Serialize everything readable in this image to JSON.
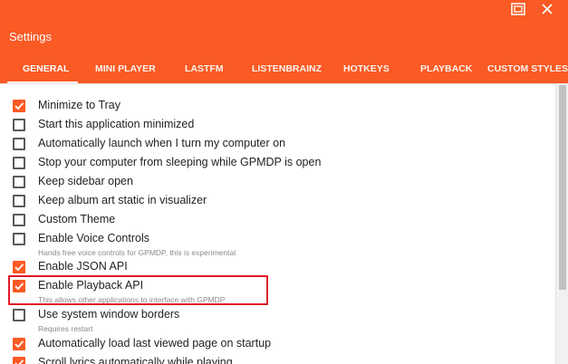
{
  "window": {
    "title": "Settings",
    "buttons": {
      "restore_icon": "restore-icon",
      "close_icon": "close-icon"
    }
  },
  "colors": {
    "accent": "#fa5a24",
    "highlight_box": "#e0182a"
  },
  "tabs": [
    {
      "label": "GENERAL",
      "active": true
    },
    {
      "label": "MINI PLAYER",
      "active": false
    },
    {
      "label": "LASTFM",
      "active": false
    },
    {
      "label": "LISTENBRAINZ",
      "active": false
    },
    {
      "label": "HOTKEYS",
      "active": false
    },
    {
      "label": "PLAYBACK",
      "active": false
    },
    {
      "label": "CUSTOM STYLES",
      "active": false
    }
  ],
  "options": [
    {
      "label": "Minimize to Tray",
      "checked": true,
      "sub": ""
    },
    {
      "label": "Start this application minimized",
      "checked": false,
      "sub": ""
    },
    {
      "label": "Automatically launch when I turn my computer on",
      "checked": false,
      "sub": ""
    },
    {
      "label": "Stop your computer from sleeping while GPMDP is open",
      "checked": false,
      "sub": ""
    },
    {
      "label": "Keep sidebar open",
      "checked": false,
      "sub": ""
    },
    {
      "label": "Keep album art static in visualizer",
      "checked": false,
      "sub": ""
    },
    {
      "label": "Custom Theme",
      "checked": false,
      "sub": ""
    },
    {
      "label": "Enable Voice Controls",
      "checked": false,
      "sub": "Hands free voice controls for GPMDP, this is experimental"
    },
    {
      "label": "Enable JSON API",
      "checked": true,
      "sub": ""
    },
    {
      "label": "Enable Playback API",
      "checked": true,
      "sub": "This allows other applications to interface with GPMDP"
    },
    {
      "label": "Use system window borders",
      "checked": false,
      "sub": "Requires restart"
    },
    {
      "label": "Automatically load last viewed page on startup",
      "checked": true,
      "sub": ""
    },
    {
      "label": "Scroll lyrics automatically while playing",
      "checked": true,
      "sub": ""
    }
  ]
}
